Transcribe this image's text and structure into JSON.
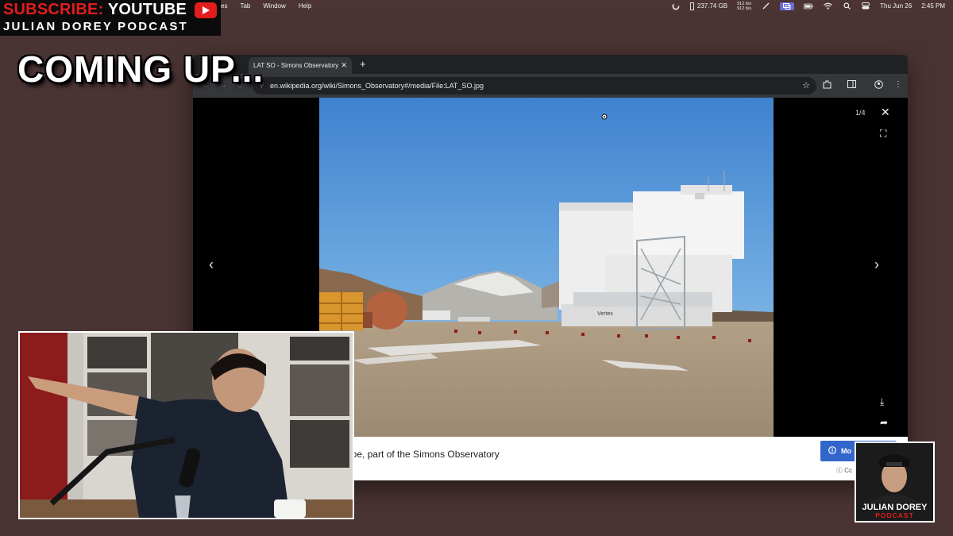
{
  "menubar": {
    "menus": [
      "es",
      "Tab",
      "Window",
      "Help"
    ],
    "disk": "237.74 GB",
    "net_up": "912 b/s",
    "net_down": "912 b/s",
    "date": "Thu Jun 26",
    "time": "2:45 PM"
  },
  "overlay": {
    "subscribe_red": "SUBSCRIBE:",
    "subscribe_white": "YOUTUBE",
    "podcast": "JULIAN DOREY PODCAST",
    "coming_up": "COMING UP...",
    "logo_name": "JULIAN DOREY",
    "logo_sub": "PODCAST"
  },
  "browser": {
    "tab_title": "LAT SO - Simons Observatory",
    "url": "en.wikipedia.org/wiki/Simons_Observatory#/media/File:LAT_SO.jpg"
  },
  "viewer": {
    "counter": "1/4",
    "caption": "ope, part of the Simons Observatory",
    "more_label": "Mo",
    "license": "Cc",
    "building_text": "Vertex"
  },
  "colors": {
    "background": "#4a3333",
    "accent_red": "#e21d1d",
    "wiki_blue": "#3366cc"
  },
  "icons": [
    "spinner-icon",
    "wifi-icon",
    "search-icon",
    "control-center-icon",
    "star-icon",
    "extensions-icon",
    "profile-icon",
    "close-icon",
    "fullscreen-icon",
    "download-icon",
    "share-icon",
    "chevron-left-icon",
    "chevron-right-icon"
  ]
}
